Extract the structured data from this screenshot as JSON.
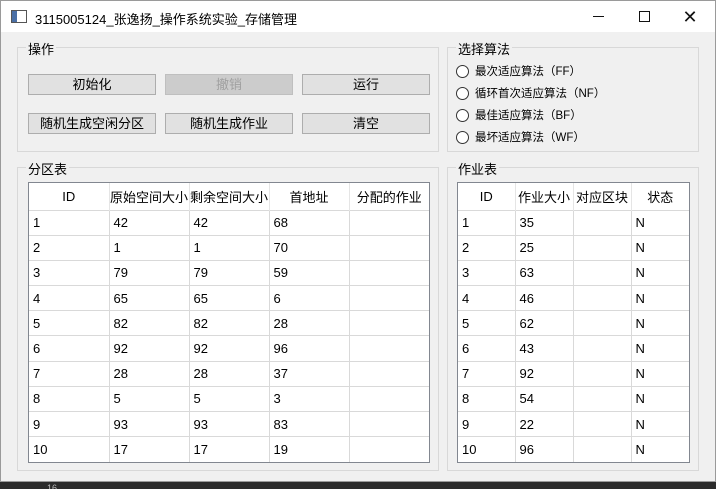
{
  "window": {
    "title": "3115005124_张逸扬_操作系统实验_存储管理"
  },
  "ops": {
    "title": "操作",
    "buttons": {
      "init": "初始化",
      "undo": "撤销",
      "run": "运行",
      "random_partition": "随机生成空闲分区",
      "random_job": "随机生成作业",
      "clear": "清空"
    }
  },
  "algorithm": {
    "title": "选择算法",
    "options": [
      "最次适应算法（FF）",
      "循环首次适应算法（NF）",
      "最佳适应算法（BF）",
      "最坏适应算法（WF）"
    ]
  },
  "partition_table": {
    "title": "分区表",
    "columns": [
      "ID",
      "原始空间大小",
      "剩余空间大小",
      "首地址",
      "分配的作业"
    ],
    "rows": [
      [
        "1",
        "42",
        "42",
        "68",
        ""
      ],
      [
        "2",
        "1",
        "1",
        "70",
        ""
      ],
      [
        "3",
        "79",
        "79",
        "59",
        ""
      ],
      [
        "4",
        "65",
        "65",
        "6",
        ""
      ],
      [
        "5",
        "82",
        "82",
        "28",
        ""
      ],
      [
        "6",
        "92",
        "92",
        "96",
        ""
      ],
      [
        "7",
        "28",
        "28",
        "37",
        ""
      ],
      [
        "8",
        "5",
        "5",
        "3",
        ""
      ],
      [
        "9",
        "93",
        "93",
        "83",
        ""
      ],
      [
        "10",
        "17",
        "17",
        "19",
        ""
      ]
    ]
  },
  "job_table": {
    "title": "作业表",
    "columns": [
      "ID",
      "作业大小",
      "对应区块",
      "状态"
    ],
    "rows": [
      [
        "1",
        "35",
        "",
        "N"
      ],
      [
        "2",
        "25",
        "",
        "N"
      ],
      [
        "3",
        "63",
        "",
        "N"
      ],
      [
        "4",
        "46",
        "",
        "N"
      ],
      [
        "5",
        "62",
        "",
        "N"
      ],
      [
        "6",
        "43",
        "",
        "N"
      ],
      [
        "7",
        "92",
        "",
        "N"
      ],
      [
        "8",
        "54",
        "",
        "N"
      ],
      [
        "9",
        "22",
        "",
        "N"
      ],
      [
        "10",
        "96",
        "",
        "N"
      ]
    ]
  },
  "taskbar_hint": "16"
}
